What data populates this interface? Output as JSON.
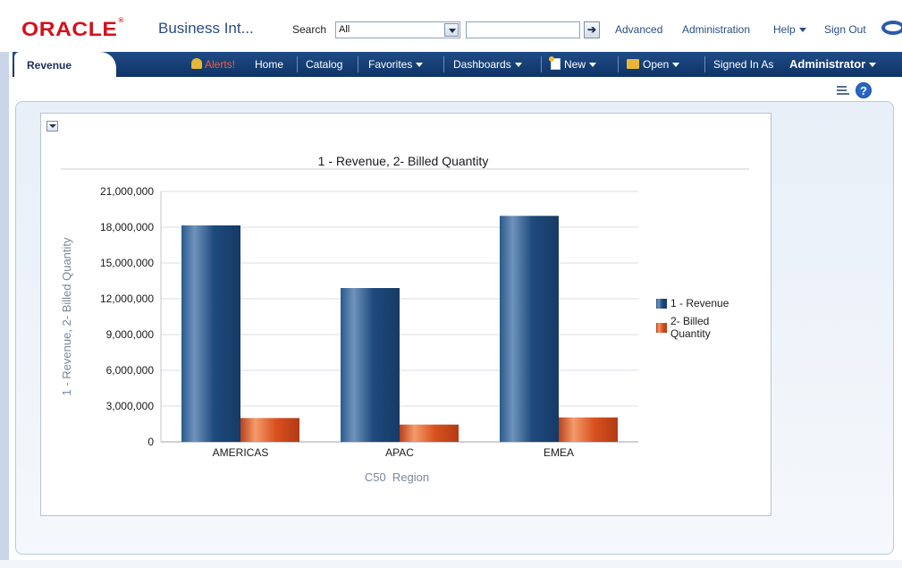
{
  "header": {
    "logo": "ORACLE",
    "app_title": "Business Int...",
    "search_label": "Search",
    "search_scope": "All",
    "search_value": "",
    "links": [
      "Advanced",
      "Administration",
      "Help",
      "Sign Out"
    ]
  },
  "nav": {
    "active_tab": "Revenue",
    "alerts": "Alerts!",
    "home": "Home",
    "catalog": "Catalog",
    "favorites": "Favorites",
    "dashboards": "Dashboards",
    "new": "New",
    "open": "Open",
    "signed_in_as": "Signed In As",
    "user": "Administrator"
  },
  "colors": {
    "brand_red": "#d3111d",
    "nav_blue": "#123a72",
    "revenue": "#1f4e82",
    "quantity": "#e05a2c"
  },
  "chart_data": {
    "type": "bar",
    "title": "1 - Revenue, 2- Billed Quantity",
    "xlabel": "C50  Region",
    "ylabel": "1 - Revenue, 2- Billed Quantity",
    "categories": [
      "AMERICAS",
      "APAC",
      "EMEA"
    ],
    "ylim": [
      0,
      21000000
    ],
    "yticks": [
      "0",
      "3,000,000",
      "6,000,000",
      "9,000,000",
      "12,000,000",
      "15,000,000",
      "18,000,000",
      "21,000,000"
    ],
    "ytick_values": [
      0,
      3000000,
      6000000,
      9000000,
      12000000,
      15000000,
      18000000,
      21000000
    ],
    "series": [
      {
        "name": "1 - Revenue",
        "values": [
          18150000,
          12900000,
          18950000
        ]
      },
      {
        "name": "2- Billed Quantity",
        "values": [
          2000000,
          1450000,
          2050000
        ]
      }
    ],
    "legend_labels": [
      "1 - Revenue",
      "2- Billed",
      "Quantity"
    ],
    "legend_position": "right",
    "grid": true
  }
}
